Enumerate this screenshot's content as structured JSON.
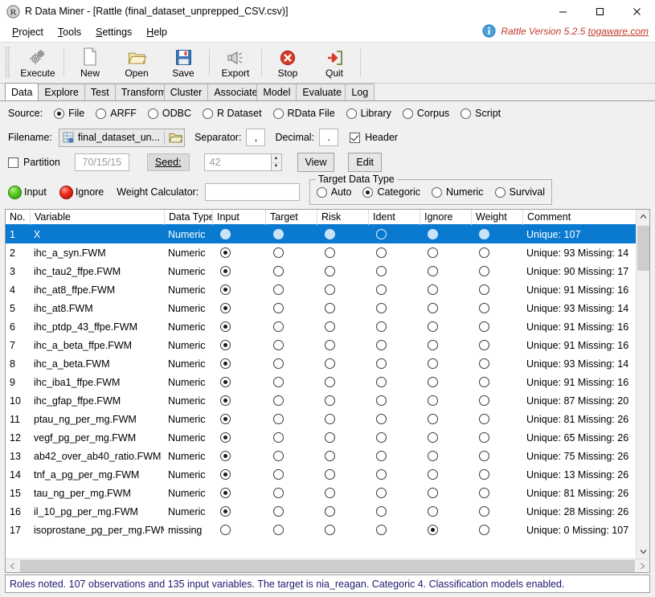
{
  "window": {
    "title": "R Data Miner - [Rattle (final_dataset_unprepped_CSV.csv)]",
    "app_icon": "rattle-r-icon",
    "minimize_label": "–",
    "maximize_label": "□",
    "close_label": "✕"
  },
  "menu": {
    "items": [
      {
        "label": "Project",
        "mnemonic": "P"
      },
      {
        "label": "Tools",
        "mnemonic": "T"
      },
      {
        "label": "Settings",
        "mnemonic": "S"
      },
      {
        "label": "Help",
        "mnemonic": "H"
      }
    ]
  },
  "version_banner": {
    "icon": "info-icon",
    "text": "Rattle Version 5.2.5 ",
    "url_text": "togaware.com"
  },
  "toolbar": {
    "buttons": [
      {
        "label": "Execute",
        "icon": "gears-icon"
      },
      {
        "label": "New",
        "icon": "new-document-icon"
      },
      {
        "label": "Open",
        "icon": "open-folder-icon"
      },
      {
        "label": "Save",
        "icon": "floppy-disk-icon"
      },
      {
        "label": "Export",
        "icon": "export-icon"
      },
      {
        "label": "Stop",
        "icon": "stop-icon"
      },
      {
        "label": "Quit",
        "icon": "quit-icon"
      }
    ]
  },
  "tabs": [
    {
      "label": "Data",
      "active": true
    },
    {
      "label": "Explore",
      "active": false
    },
    {
      "label": "Test",
      "active": false
    },
    {
      "label": "Transform",
      "active": false
    },
    {
      "label": "Cluster",
      "active": false
    },
    {
      "label": "Associate",
      "active": false
    },
    {
      "label": "Model",
      "active": false
    },
    {
      "label": "Evaluate",
      "active": false
    },
    {
      "label": "Log",
      "active": false
    }
  ],
  "source_row": {
    "label": "Source:",
    "options": [
      {
        "label": "File",
        "selected": true
      },
      {
        "label": "ARFF",
        "selected": false
      },
      {
        "label": "ODBC",
        "selected": false
      },
      {
        "label": "R Dataset",
        "selected": false
      },
      {
        "label": "RData File",
        "selected": false
      },
      {
        "label": "Library",
        "selected": false
      },
      {
        "label": "Corpus",
        "selected": false
      },
      {
        "label": "Script",
        "selected": false
      }
    ]
  },
  "file_row": {
    "filename_label": "Filename:",
    "filename_value": "final_dataset_un...",
    "file_icon": "spreadsheet-file-icon",
    "browse_icon": "folder-icon",
    "separator_label": "Separator:",
    "separator_value": ",",
    "decimal_label": "Decimal:",
    "decimal_value": ".",
    "header_label": "Header",
    "header_checked": true
  },
  "partition_row": {
    "partition_label": "Partition",
    "partition_checked": false,
    "partition_value": "70/15/15",
    "seed_label": "Seed:",
    "seed_value": "42",
    "view_label": "View",
    "edit_label": "Edit"
  },
  "roles_row": {
    "input_label": "Input",
    "ignore_label": "Ignore",
    "weight_label": "Weight Calculator:",
    "weight_value": "",
    "target_group_label": "Target Data Type",
    "target_options": [
      {
        "label": "Auto",
        "selected": false
      },
      {
        "label": "Categoric",
        "selected": true
      },
      {
        "label": "Numeric",
        "selected": false
      },
      {
        "label": "Survival",
        "selected": false
      }
    ]
  },
  "table": {
    "columns": [
      "No.",
      "Variable",
      "Data Type",
      "Input",
      "Target",
      "Risk",
      "Ident",
      "Ignore",
      "Weight",
      "Comment"
    ],
    "rows": [
      {
        "no": "1",
        "variable": "X",
        "datatype": "Numeric",
        "role": "Ident",
        "comment": "Unique: 107",
        "selected": true
      },
      {
        "no": "2",
        "variable": "ihc_a_syn.FWM",
        "datatype": "Numeric",
        "role": "Input",
        "comment": "Unique: 93 Missing: 14",
        "selected": false
      },
      {
        "no": "3",
        "variable": "ihc_tau2_ffpe.FWM",
        "datatype": "Numeric",
        "role": "Input",
        "comment": "Unique: 90 Missing: 17",
        "selected": false
      },
      {
        "no": "4",
        "variable": "ihc_at8_ffpe.FWM",
        "datatype": "Numeric",
        "role": "Input",
        "comment": "Unique: 91 Missing: 16",
        "selected": false
      },
      {
        "no": "5",
        "variable": "ihc_at8.FWM",
        "datatype": "Numeric",
        "role": "Input",
        "comment": "Unique: 93 Missing: 14",
        "selected": false
      },
      {
        "no": "6",
        "variable": "ihc_ptdp_43_ffpe.FWM",
        "datatype": "Numeric",
        "role": "Input",
        "comment": "Unique: 91 Missing: 16",
        "selected": false
      },
      {
        "no": "7",
        "variable": "ihc_a_beta_ffpe.FWM",
        "datatype": "Numeric",
        "role": "Input",
        "comment": "Unique: 91 Missing: 16",
        "selected": false
      },
      {
        "no": "8",
        "variable": "ihc_a_beta.FWM",
        "datatype": "Numeric",
        "role": "Input",
        "comment": "Unique: 93 Missing: 14",
        "selected": false
      },
      {
        "no": "9",
        "variable": "ihc_iba1_ffpe.FWM",
        "datatype": "Numeric",
        "role": "Input",
        "comment": "Unique: 91 Missing: 16",
        "selected": false
      },
      {
        "no": "10",
        "variable": "ihc_gfap_ffpe.FWM",
        "datatype": "Numeric",
        "role": "Input",
        "comment": "Unique: 87 Missing: 20",
        "selected": false
      },
      {
        "no": "11",
        "variable": "ptau_ng_per_mg.FWM",
        "datatype": "Numeric",
        "role": "Input",
        "comment": "Unique: 81 Missing: 26",
        "selected": false
      },
      {
        "no": "12",
        "variable": "vegf_pg_per_mg.FWM",
        "datatype": "Numeric",
        "role": "Input",
        "comment": "Unique: 65 Missing: 26",
        "selected": false
      },
      {
        "no": "13",
        "variable": "ab42_over_ab40_ratio.FWM",
        "datatype": "Numeric",
        "role": "Input",
        "comment": "Unique: 75 Missing: 26",
        "selected": false
      },
      {
        "no": "14",
        "variable": "tnf_a_pg_per_mg.FWM",
        "datatype": "Numeric",
        "role": "Input",
        "comment": "Unique: 13 Missing: 26",
        "selected": false
      },
      {
        "no": "15",
        "variable": "tau_ng_per_mg.FWM",
        "datatype": "Numeric",
        "role": "Input",
        "comment": "Unique: 81 Missing: 26",
        "selected": false
      },
      {
        "no": "16",
        "variable": "il_10_pg_per_mg.FWM",
        "datatype": "Numeric",
        "role": "Input",
        "comment": "Unique: 28 Missing: 26",
        "selected": false
      },
      {
        "no": "17",
        "variable": "isoprostane_pg_per_mg.FWM",
        "datatype": "missing",
        "role": "Ignore",
        "comment": "Unique: 0 Missing: 107",
        "selected": false
      }
    ]
  },
  "statusbar": {
    "text": "Roles noted. 107 observations and 135 input variables. The target is nia_reagan. Categoric 4. Classification models enabled."
  }
}
